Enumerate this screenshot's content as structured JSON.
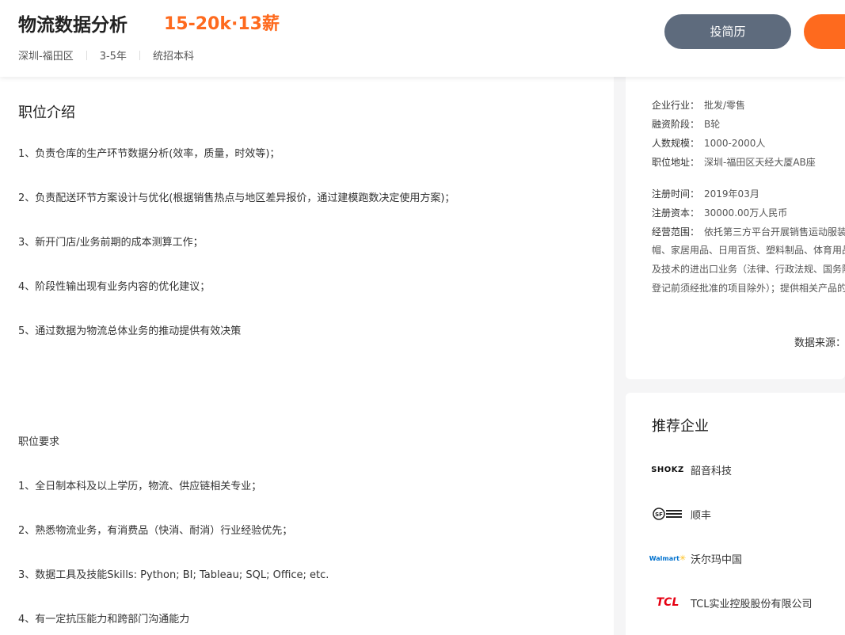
{
  "header": {
    "title": "物流数据分析",
    "salary": "15-20k·13薪",
    "location": "深圳-福田区",
    "experience": "3-5年",
    "education": "统招本科",
    "resume_btn": "投简历"
  },
  "description": {
    "title": "职位介绍",
    "duties": [
      "1、负责仓库的生产环节数据分析(效率，质量，时效等)；",
      "2、负责配送环节方案设计与优化(根据销售热点与地区差异报价，通过建模跑数决定使用方案)；",
      "3、新开门店/业务前期的成本测算工作；",
      "4、阶段性输出现有业务内容的优化建议；",
      "5、通过数据为物流总体业务的推动提供有效决策"
    ],
    "req_title": "职位要求",
    "requirements": [
      "1、全日制本科及以上学历，物流、供应链相关专业；",
      "2、熟悉物流业务，有消费品（快消、耐消）行业经验优先；",
      "3、数据工具及技能Skills: Python; BI; Tableau; SQL; Office; etc.",
      "4、有一定抗压能力和跨部门沟通能力"
    ]
  },
  "company_info": {
    "rows": [
      {
        "label": "企业行业：",
        "value": "批发/零售"
      },
      {
        "label": "融资阶段：",
        "value": "B轮"
      },
      {
        "label": "人数规模：",
        "value": "1000-2000人"
      },
      {
        "label": "职位地址：",
        "value": "深圳-福田区天经大厦AB座"
      },
      {
        "label": "注册时间：",
        "value": "2019年03月"
      },
      {
        "label": "注册资本：",
        "value": "30000.00万人民币"
      },
      {
        "label": "经营范围：",
        "value": "依托第三方平台开展销售运动服装"
      }
    ],
    "scope_lines": [
      "帽、家居用品、日用百货、塑料制品、体育用品",
      "及技术的进出口业务（法律、行政法规、国务院",
      "登记前须经批准的项目除外）；提供相关产品的"
    ],
    "source": "数据来源："
  },
  "recommend": {
    "title": "推荐企业",
    "companies": [
      {
        "name": "韶音科技",
        "logo": "SHOKZ",
        "color": "#111111"
      },
      {
        "name": "顺丰",
        "logo": "SF EXPRESS",
        "color": "#222222"
      },
      {
        "name": "沃尔玛中国",
        "logo": "Walmart",
        "color": "#0071ce"
      },
      {
        "name": "TCL实业控股股份有限公司",
        "logo": "TCL",
        "color": "#e60012"
      }
    ]
  }
}
